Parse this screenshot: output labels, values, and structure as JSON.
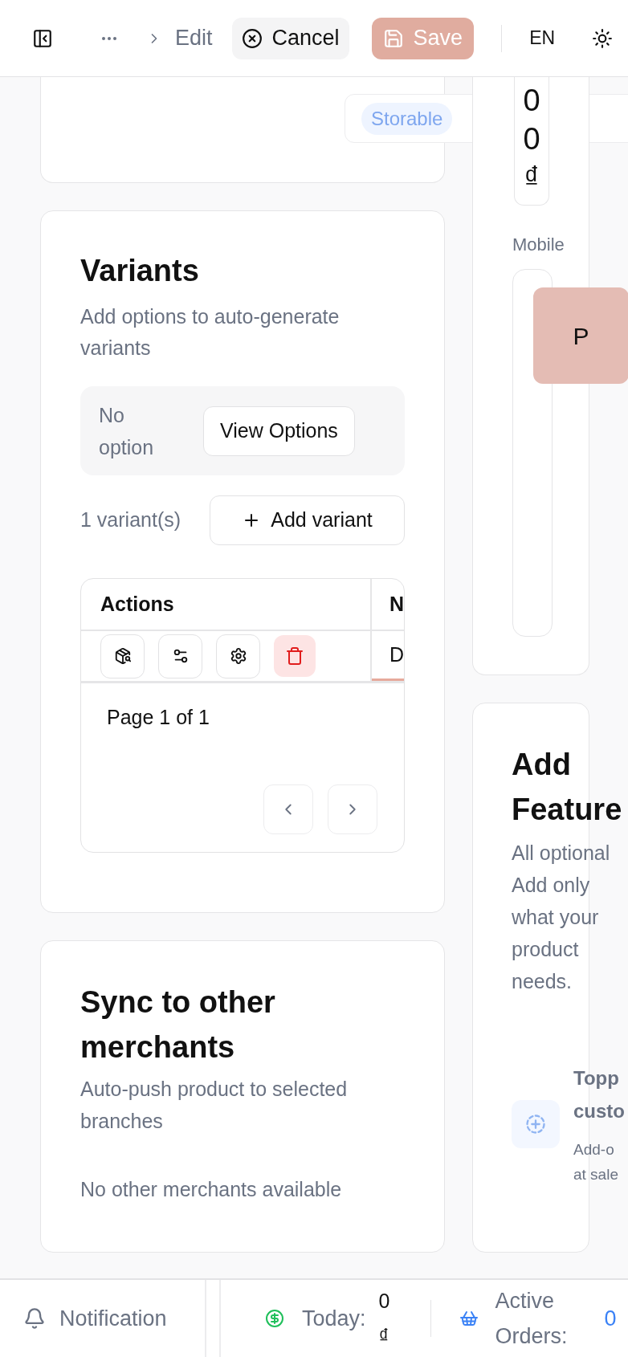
{
  "header": {
    "breadcrumb": [
      {
        "label": "Edit"
      }
    ],
    "cancel": "Cancel",
    "save": {
      "label": "Save",
      "disabled": true
    },
    "language": "EN"
  },
  "type_field": {
    "badge": "Storable"
  },
  "variants": {
    "title": "Variants",
    "subtitle": "Add options to auto-generate variants",
    "empty_options": "No option",
    "view_options": "View Options",
    "count": "1 variant(s)",
    "add_variant": "Add variant",
    "table": {
      "columns": [
        "Actions",
        "N"
      ],
      "rows": [
        {
          "column_2": "D"
        }
      ]
    },
    "pagination": "Page 1 of 1"
  },
  "sync": {
    "title": "Sync to other merchants",
    "subtitle": "Auto-push product to selected branches",
    "empty": "No other merchants available"
  },
  "price": {
    "value": "00₫"
  },
  "mobile": {
    "label": "Mobile",
    "tile": "P"
  },
  "features": {
    "title": "Add Feature",
    "subtitle": "All optional Add only what your product needs.",
    "items": [
      {
        "title": "Topp custo",
        "description": "Add-o at sale"
      }
    ]
  },
  "status_bar": {
    "notification": "Notification",
    "today_label": "Today:",
    "today_value": "0 ₫",
    "orders_label": "Active Orders:",
    "orders_value": "0"
  }
}
